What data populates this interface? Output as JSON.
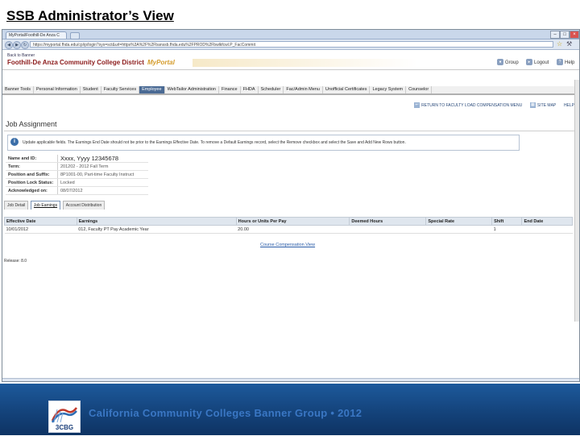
{
  "slide_title": "SSB Administrator’s View",
  "browser": {
    "tab_title": "MyPortal/Foothill-De Anza C",
    "url": "https://myportal.fhda.edu/cp/ip/login?sys=sct&url=https%3A%2F%2Fbanssb.fhda.edu%2FPROD%2Fbwlkfcwl.P_FacCommit",
    "minimize": "–",
    "maximize": "□",
    "close": "×",
    "back": "◀",
    "forward": "▶",
    "reload": "↻",
    "star": "☆",
    "wrench": "⚒"
  },
  "portal": {
    "go_back": "Back to Banner Hub",
    "district": "Foothill-De Anza Community College District",
    "brand": "MyPortal",
    "group_label": "Group",
    "logout_label": "Logout",
    "help_label": "Help"
  },
  "menu": {
    "items": [
      "Banner Tools",
      "Personal Information",
      "Student",
      "Faculty Services",
      "Employee",
      "WebTailor Administration",
      "Finance",
      "FHDA",
      "Scheduler",
      "Fac/Admin Menu",
      "Unofficial Certificates",
      "Legacy System",
      "Counselor"
    ],
    "active_index": 4
  },
  "links": {
    "return_label": "RETURN TO FACULTY LOAD COMPENSATION MENU",
    "sitemap_label": "SITE MAP",
    "help_label": "HELP"
  },
  "page": {
    "heading": "Job Assignment",
    "info_message": "Update applicable fields. The Earnings End Date should not be prior to the Earnings Effective Date. To remove a Default Earnings record, select the Remove checkbox and select the Save and Add New Rows button.",
    "release": "Release: 8.0"
  },
  "details": {
    "name_label": "Name and ID:",
    "name_value": "Xxxx, Yyyy   12345678",
    "term_label": "Term:",
    "term_value": "201202 - 2012 Fall Term",
    "position_label": "Position and Suffix:",
    "position_value": "8P1001-00, Part-time Faculty Instruct",
    "lock_label": "Position Lock Status:",
    "lock_value": "Locked",
    "ack_label": "Acknowledged on:",
    "ack_value": "08/07/2012"
  },
  "subtabs": {
    "job_detail": "Job Detail",
    "job_earnings": "Job Earnings",
    "account_distribution": "Account Distribution"
  },
  "earnings": {
    "headers": [
      "Effective Date",
      "Earnings",
      "Hours or Units Per Pay",
      "Deemed Hours",
      "Special Rate",
      "Shift",
      "End Date"
    ],
    "rows": [
      [
        "10/01/2012",
        "012, Faculty PT Pay Academic Year",
        "20.00",
        "",
        "",
        "1",
        ""
      ]
    ]
  },
  "course_link": "Course Compensation View",
  "footer": {
    "logo_text": "3CBG",
    "text": "California Community Colleges Banner Group  •  2012"
  }
}
